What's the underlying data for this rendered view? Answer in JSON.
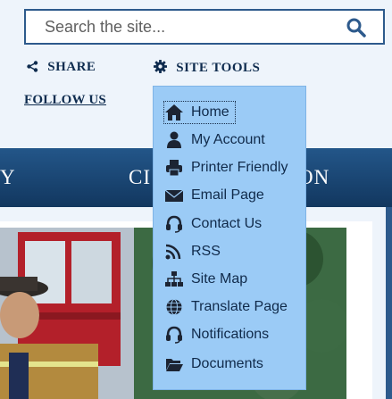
{
  "search": {
    "placeholder": "Search the site..."
  },
  "toolbar": {
    "share_label": "SHARE",
    "site_tools_label": "SITE TOOLS",
    "follow_label": "FOLLOW US"
  },
  "nav": {
    "items": [
      "Y",
      "CI",
      "ON"
    ]
  },
  "site_tools_menu": {
    "items": [
      {
        "label": "Home",
        "icon": "home-icon"
      },
      {
        "label": "My Account",
        "icon": "user-icon"
      },
      {
        "label": "Printer Friendly",
        "icon": "printer-icon"
      },
      {
        "label": "Email Page",
        "icon": "envelope-icon"
      },
      {
        "label": "Contact Us",
        "icon": "headset-icon"
      },
      {
        "label": "RSS",
        "icon": "rss-icon"
      },
      {
        "label": "Site Map",
        "icon": "sitemap-icon"
      },
      {
        "label": "Translate Page",
        "icon": "globe-icon"
      },
      {
        "label": "Notifications",
        "icon": "headset-icon"
      },
      {
        "label": "Documents",
        "icon": "folder-open-icon"
      }
    ]
  },
  "colors": {
    "navy": "#0f2c4f",
    "nav_bar": "#1c4a7a",
    "dropdown_bg": "#9bcbf6",
    "page_bg": "#eef4fb"
  }
}
